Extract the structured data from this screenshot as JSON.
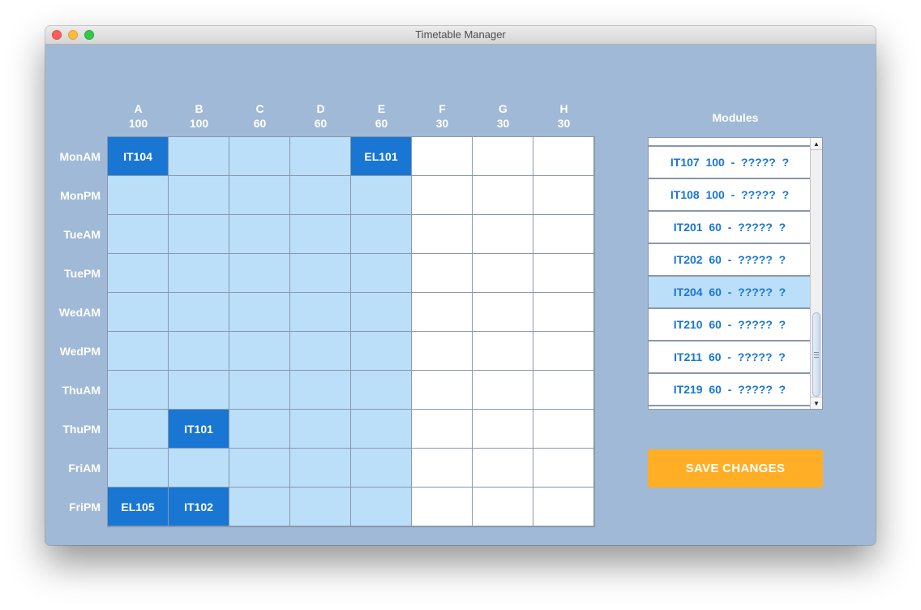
{
  "window": {
    "title": "Timetable Manager"
  },
  "timetable": {
    "columns": [
      {
        "name": "A",
        "capacity": "100"
      },
      {
        "name": "B",
        "capacity": "100"
      },
      {
        "name": "C",
        "capacity": "60"
      },
      {
        "name": "D",
        "capacity": "60"
      },
      {
        "name": "E",
        "capacity": "60"
      },
      {
        "name": "F",
        "capacity": "30"
      },
      {
        "name": "G",
        "capacity": "30"
      },
      {
        "name": "H",
        "capacity": "30"
      }
    ],
    "rows": [
      "MonAM",
      "MonPM",
      "TueAM",
      "TuePM",
      "WedAM",
      "WedPM",
      "ThuAM",
      "ThuPM",
      "FriAM",
      "FriPM"
    ],
    "highlighted_columns": [
      "A",
      "B",
      "C",
      "D",
      "E"
    ],
    "assignments": [
      {
        "row": "MonAM",
        "column": "A",
        "module": "IT104"
      },
      {
        "row": "MonAM",
        "column": "E",
        "module": "EL101"
      },
      {
        "row": "ThuPM",
        "column": "B",
        "module": "IT101"
      },
      {
        "row": "FriPM",
        "column": "A",
        "module": "EL105"
      },
      {
        "row": "FriPM",
        "column": "B",
        "module": "IT102"
      }
    ]
  },
  "modules": {
    "title": "Modules",
    "items": [
      {
        "label": "",
        "selected": false
      },
      {
        "label": "IT107  100  -  ?????  ?",
        "selected": false
      },
      {
        "label": "IT108  100  -  ?????  ?",
        "selected": false
      },
      {
        "label": "IT201  60  -  ?????  ?",
        "selected": false
      },
      {
        "label": "IT202  60  -  ?????  ?",
        "selected": false
      },
      {
        "label": "IT204  60  -  ?????  ?",
        "selected": true
      },
      {
        "label": "IT210  60  -  ?????  ?",
        "selected": false
      },
      {
        "label": "IT211  60  -  ?????  ?",
        "selected": false
      },
      {
        "label": "IT219  60  -  ?????  ?",
        "selected": false
      },
      {
        "label": "",
        "selected": false
      }
    ]
  },
  "actions": {
    "save_label": "SAVE CHANGES"
  },
  "colors": {
    "window_background": "#a0b9d6",
    "available_cell": "#bbdef9",
    "assigned_cell": "#1976d2",
    "empty_cell": "#ffffff",
    "module_text": "#1976d2",
    "save_button": "#ffae26"
  }
}
